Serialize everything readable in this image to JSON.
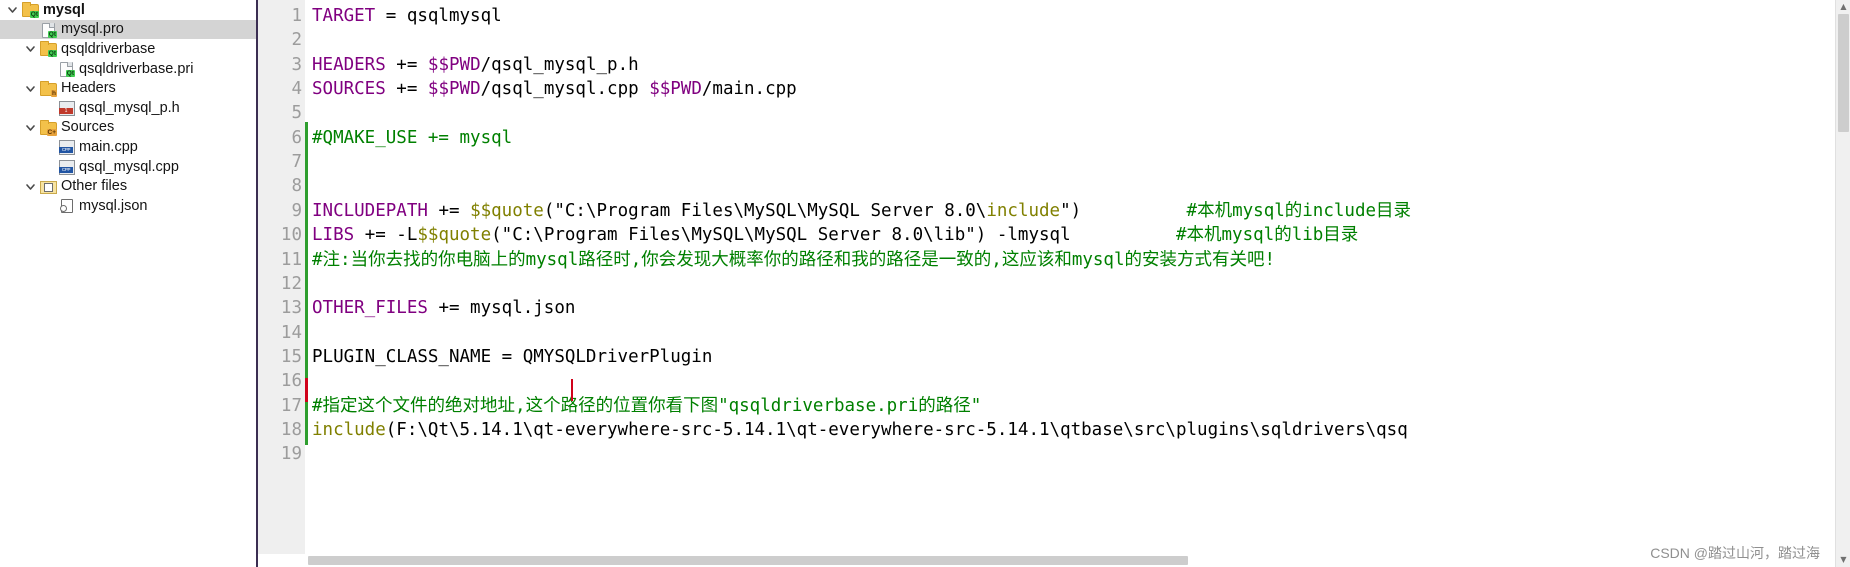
{
  "sidebar": {
    "items": [
      {
        "label": "mysql",
        "indent": 0,
        "icon": "qt-project-folder-icon",
        "chevron": "expanded",
        "bold": true,
        "selected": false
      },
      {
        "label": "mysql.pro",
        "indent": 1,
        "icon": "qt-pro-file-icon",
        "chevron": "none",
        "bold": false,
        "selected": true
      },
      {
        "label": "qsqldriverbase",
        "indent": 1,
        "icon": "qt-project-folder-icon",
        "chevron": "expanded",
        "bold": false,
        "selected": false
      },
      {
        "label": "qsqldriverbase.pri",
        "indent": 2,
        "icon": "qt-pri-file-icon",
        "chevron": "none",
        "bold": false,
        "selected": false
      },
      {
        "label": "Headers",
        "indent": 1,
        "icon": "headers-folder-icon",
        "chevron": "expanded",
        "bold": false,
        "selected": false
      },
      {
        "label": "qsql_mysql_p.h",
        "indent": 2,
        "icon": "header-file-icon",
        "chevron": "none",
        "bold": false,
        "selected": false
      },
      {
        "label": "Sources",
        "indent": 1,
        "icon": "sources-folder-icon",
        "chevron": "expanded",
        "bold": false,
        "selected": false
      },
      {
        "label": "main.cpp",
        "indent": 2,
        "icon": "cpp-file-icon",
        "chevron": "none",
        "bold": false,
        "selected": false
      },
      {
        "label": "qsql_mysql.cpp",
        "indent": 2,
        "icon": "cpp-file-icon",
        "chevron": "none",
        "bold": false,
        "selected": false
      },
      {
        "label": "Other files",
        "indent": 1,
        "icon": "other-files-folder-icon",
        "chevron": "expanded",
        "bold": false,
        "selected": false
      },
      {
        "label": "mysql.json",
        "indent": 2,
        "icon": "json-file-icon",
        "chevron": "none",
        "bold": false,
        "selected": false
      }
    ]
  },
  "editor": {
    "language": "qmake",
    "colors": {
      "keyword": "#800080",
      "comment": "#008000",
      "function": "#808000",
      "plain": "#000000",
      "gutter_bg": "#efefef",
      "line_number": "#9c9c9c",
      "change_bar_modified": "#2e9e2e",
      "change_bar_unsaved": "#d0021b",
      "selection_bg": "#d4d4d4"
    },
    "lines": [
      {
        "n": 1,
        "tokens": [
          {
            "t": "TARGET",
            "c": "kw"
          },
          {
            "t": " = qsqlmysql",
            "c": "plain"
          }
        ]
      },
      {
        "n": 2,
        "tokens": []
      },
      {
        "n": 3,
        "tokens": [
          {
            "t": "HEADERS",
            "c": "kw"
          },
          {
            "t": " += ",
            "c": "plain"
          },
          {
            "t": "$$PWD",
            "c": "kw"
          },
          {
            "t": "/qsql_mysql_p.h",
            "c": "plain"
          }
        ]
      },
      {
        "n": 4,
        "tokens": [
          {
            "t": "SOURCES",
            "c": "kw"
          },
          {
            "t": " += ",
            "c": "plain"
          },
          {
            "t": "$$PWD",
            "c": "kw"
          },
          {
            "t": "/qsql_mysql.cpp ",
            "c": "plain"
          },
          {
            "t": "$$PWD",
            "c": "kw"
          },
          {
            "t": "/main.cpp",
            "c": "plain"
          }
        ]
      },
      {
        "n": 5,
        "tokens": []
      },
      {
        "n": 6,
        "tokens": [
          {
            "t": "#QMAKE_USE += mysql",
            "c": "cmt"
          }
        ]
      },
      {
        "n": 7,
        "tokens": []
      },
      {
        "n": 8,
        "tokens": []
      },
      {
        "n": 9,
        "tokens": [
          {
            "t": "INCLUDEPATH",
            "c": "kw"
          },
          {
            "t": " += ",
            "c": "plain"
          },
          {
            "t": "$$quote",
            "c": "fn"
          },
          {
            "t": "(\"C:\\Program Files\\MySQL\\MySQL Server 8.0\\",
            "c": "plain"
          },
          {
            "t": "include",
            "c": "fn"
          },
          {
            "t": "\")",
            "c": "plain"
          },
          {
            "t": "          ",
            "c": "plain"
          },
          {
            "t": "#本机mysql的include目录",
            "c": "cmt"
          }
        ]
      },
      {
        "n": 10,
        "tokens": [
          {
            "t": "LIBS",
            "c": "kw"
          },
          {
            "t": " += -L",
            "c": "plain"
          },
          {
            "t": "$$quote",
            "c": "fn"
          },
          {
            "t": "(\"C:\\Program Files\\MySQL\\MySQL Server 8.0\\lib\") -lmysql",
            "c": "plain"
          },
          {
            "t": "          ",
            "c": "plain"
          },
          {
            "t": "#本机mysql的lib目录",
            "c": "cmt"
          }
        ]
      },
      {
        "n": 11,
        "tokens": [
          {
            "t": "#注:当你去找的你电脑上的mysql路径时,你会发现大概率你的路径和我的路径是一致的,这应该和mysql的安装方式有关吧!",
            "c": "cmt"
          }
        ]
      },
      {
        "n": 12,
        "tokens": []
      },
      {
        "n": 13,
        "tokens": [
          {
            "t": "OTHER_FILES",
            "c": "kw"
          },
          {
            "t": " += mysql.json",
            "c": "plain"
          }
        ]
      },
      {
        "n": 14,
        "tokens": []
      },
      {
        "n": 15,
        "tokens": [
          {
            "t": "PLUGIN_CLASS_NAME = QMYSQLDriverPlugin",
            "c": "plain"
          }
        ]
      },
      {
        "n": 16,
        "tokens": []
      },
      {
        "n": 17,
        "tokens": [
          {
            "t": "#指定这个文件的绝对地址,这个路径的位置你看下图\"qsqldriverbase.pri的路径\"",
            "c": "cmt"
          }
        ]
      },
      {
        "n": 18,
        "tokens": [
          {
            "t": "include",
            "c": "fn"
          },
          {
            "t": "(F:\\Qt\\5.14.1\\qt-everywhere-src-5.14.1\\qt-everywhere-src-5.14.1\\qtbase\\src\\plugins\\sqldrivers\\qsq",
            "c": "plain"
          }
        ]
      },
      {
        "n": 19,
        "tokens": []
      }
    ]
  },
  "watermark": {
    "text": "CSDN @踏过山河，踏过海"
  },
  "scrollbars": {
    "vertical_up_arrow": "▲",
    "vertical_down_arrow": "▼"
  }
}
